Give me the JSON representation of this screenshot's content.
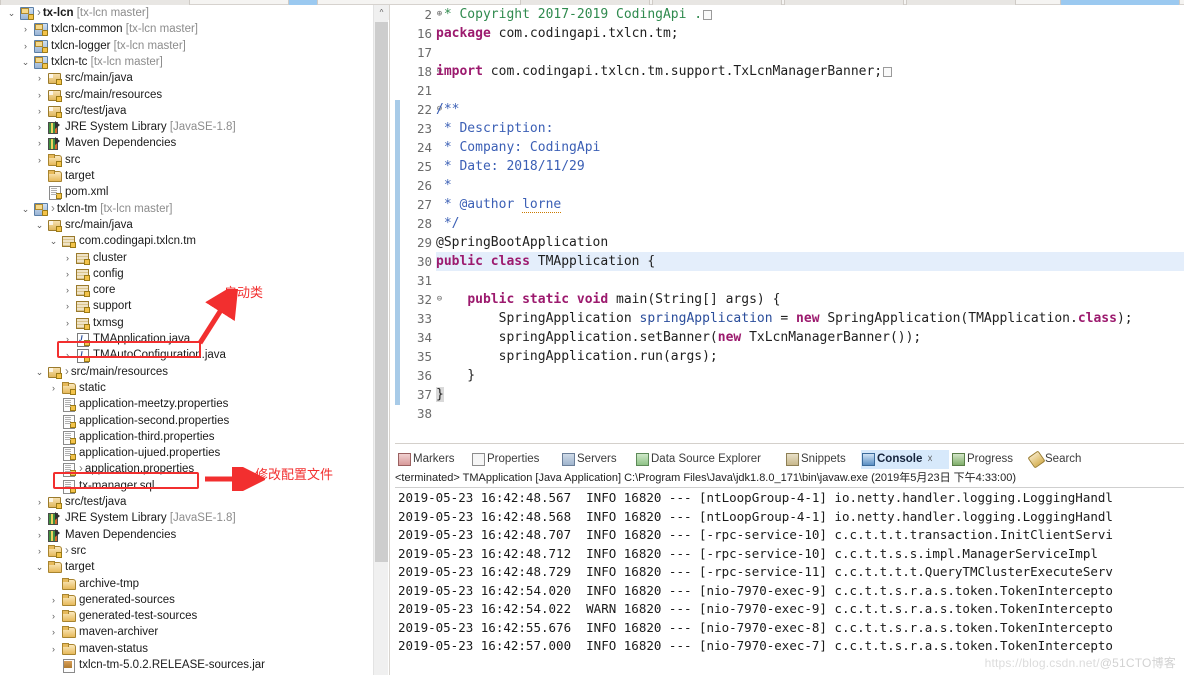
{
  "window": {
    "watermark_url": "https://blog.csdn.net/",
    "watermark_user": "@51CTO博客"
  },
  "explorer": {
    "name": "Package Explorer",
    "rows": [
      {
        "depth": 0,
        "twist": "v",
        "icon": "project",
        "text": "tx-lcn",
        "suffix": "[tx-lcn master]",
        "arrow": true,
        "bold": true
      },
      {
        "depth": 1,
        "twist": ">",
        "icon": "project",
        "text": "txlcn-common",
        "suffix": "[tx-lcn master]",
        "arrow": false,
        "bold": false
      },
      {
        "depth": 1,
        "twist": ">",
        "icon": "project",
        "text": "txlcn-logger",
        "suffix": "[tx-lcn master]",
        "arrow": false,
        "bold": false
      },
      {
        "depth": 1,
        "twist": "v",
        "icon": "project",
        "text": "txlcn-tc",
        "suffix": "[tx-lcn master]",
        "arrow": false,
        "bold": false
      },
      {
        "depth": 2,
        "twist": ">",
        "icon": "srcfolder",
        "text": "src/main/java",
        "suffix": "",
        "arrow": false,
        "bold": false
      },
      {
        "depth": 2,
        "twist": ">",
        "icon": "srcfolder",
        "text": "src/main/resources",
        "suffix": "",
        "arrow": false,
        "bold": false
      },
      {
        "depth": 2,
        "twist": ">",
        "icon": "srcfolder",
        "text": "src/test/java",
        "suffix": "",
        "arrow": false,
        "bold": false
      },
      {
        "depth": 2,
        "twist": ">",
        "icon": "library",
        "text": "JRE System Library",
        "suffix": "[JavaSE-1.8]",
        "arrow": false,
        "bold": false
      },
      {
        "depth": 2,
        "twist": ">",
        "icon": "library",
        "text": "Maven Dependencies",
        "suffix": "",
        "arrow": false,
        "bold": false
      },
      {
        "depth": 2,
        "twist": ">",
        "icon": "folder-src",
        "text": "src",
        "suffix": "",
        "arrow": false,
        "bold": false
      },
      {
        "depth": 2,
        "twist": "",
        "icon": "folder",
        "text": "target",
        "suffix": "",
        "arrow": false,
        "bold": false
      },
      {
        "depth": 2,
        "twist": "",
        "icon": "file-xml",
        "text": "pom.xml",
        "suffix": "",
        "arrow": false,
        "bold": false
      },
      {
        "depth": 1,
        "twist": "v",
        "icon": "project",
        "text": "txlcn-tm",
        "suffix": "[tx-lcn master]",
        "arrow": true,
        "bold": false
      },
      {
        "depth": 2,
        "twist": "v",
        "icon": "srcfolder",
        "text": "src/main/java",
        "suffix": "",
        "arrow": false,
        "bold": false
      },
      {
        "depth": 3,
        "twist": "v",
        "icon": "package",
        "text": "com.codingapi.txlcn.tm",
        "suffix": "",
        "arrow": false,
        "bold": false
      },
      {
        "depth": 4,
        "twist": ">",
        "icon": "package",
        "text": "cluster",
        "suffix": "",
        "arrow": false,
        "bold": false
      },
      {
        "depth": 4,
        "twist": ">",
        "icon": "package",
        "text": "config",
        "suffix": "",
        "arrow": false,
        "bold": false
      },
      {
        "depth": 4,
        "twist": ">",
        "icon": "package",
        "text": "core",
        "suffix": "",
        "arrow": false,
        "bold": false
      },
      {
        "depth": 4,
        "twist": ">",
        "icon": "package",
        "text": "support",
        "suffix": "",
        "arrow": false,
        "bold": false
      },
      {
        "depth": 4,
        "twist": ">",
        "icon": "package",
        "text": "txmsg",
        "suffix": "",
        "arrow": false,
        "bold": false
      },
      {
        "depth": 4,
        "twist": ">",
        "icon": "java",
        "text": "TMApplication.java",
        "suffix": "",
        "arrow": false,
        "bold": false
      },
      {
        "depth": 4,
        "twist": ">",
        "icon": "java",
        "text": "TMAutoConfiguration.java",
        "suffix": "",
        "arrow": false,
        "bold": false
      },
      {
        "depth": 2,
        "twist": "v",
        "icon": "srcfolder",
        "text": "src/main/resources",
        "suffix": "",
        "arrow": true,
        "bold": false
      },
      {
        "depth": 3,
        "twist": ">",
        "icon": "folder-src",
        "text": "static",
        "suffix": "",
        "arrow": false,
        "bold": false
      },
      {
        "depth": 3,
        "twist": "",
        "icon": "file-props",
        "text": "application-meetzy.properties",
        "suffix": "",
        "arrow": false,
        "bold": false
      },
      {
        "depth": 3,
        "twist": "",
        "icon": "file-props",
        "text": "application-second.properties",
        "suffix": "",
        "arrow": false,
        "bold": false
      },
      {
        "depth": 3,
        "twist": "",
        "icon": "file-props",
        "text": "application-third.properties",
        "suffix": "",
        "arrow": false,
        "bold": false
      },
      {
        "depth": 3,
        "twist": "",
        "icon": "file-props",
        "text": "application-ujued.properties",
        "suffix": "",
        "arrow": false,
        "bold": false
      },
      {
        "depth": 3,
        "twist": "",
        "icon": "file-props",
        "text": "application.properties",
        "suffix": "",
        "arrow": true,
        "bold": false
      },
      {
        "depth": 3,
        "twist": "",
        "icon": "file-sql",
        "text": "tx-manager.sql",
        "suffix": "",
        "arrow": false,
        "bold": false
      },
      {
        "depth": 2,
        "twist": ">",
        "icon": "srcfolder",
        "text": "src/test/java",
        "suffix": "",
        "arrow": false,
        "bold": false
      },
      {
        "depth": 2,
        "twist": ">",
        "icon": "library",
        "text": "JRE System Library",
        "suffix": "[JavaSE-1.8]",
        "arrow": false,
        "bold": false
      },
      {
        "depth": 2,
        "twist": ">",
        "icon": "library",
        "text": "Maven Dependencies",
        "suffix": "",
        "arrow": false,
        "bold": false
      },
      {
        "depth": 2,
        "twist": ">",
        "icon": "folder-src",
        "text": "src",
        "suffix": "",
        "arrow": true,
        "bold": false
      },
      {
        "depth": 2,
        "twist": "v",
        "icon": "folder",
        "text": "target",
        "suffix": "",
        "arrow": false,
        "bold": false
      },
      {
        "depth": 3,
        "twist": "",
        "icon": "folder",
        "text": "archive-tmp",
        "suffix": "",
        "arrow": false,
        "bold": false
      },
      {
        "depth": 3,
        "twist": ">",
        "icon": "folder",
        "text": "generated-sources",
        "suffix": "",
        "arrow": false,
        "bold": false
      },
      {
        "depth": 3,
        "twist": ">",
        "icon": "folder",
        "text": "generated-test-sources",
        "suffix": "",
        "arrow": false,
        "bold": false
      },
      {
        "depth": 3,
        "twist": ">",
        "icon": "folder",
        "text": "maven-archiver",
        "suffix": "",
        "arrow": false,
        "bold": false
      },
      {
        "depth": 3,
        "twist": ">",
        "icon": "folder",
        "text": "maven-status",
        "suffix": "",
        "arrow": false,
        "bold": false
      },
      {
        "depth": 3,
        "twist": "",
        "icon": "jar",
        "text": "txlcn-tm-5.0.2.RELEASE-sources.jar",
        "suffix": "",
        "arrow": false,
        "bold": false
      }
    ]
  },
  "annotations": [
    {
      "id": "startup-class",
      "text": "启动类",
      "target": "TMApplication.java"
    },
    {
      "id": "modify-config",
      "text": "修改配置文件",
      "target": "application.properties"
    }
  ],
  "editor": {
    "lines": [
      {
        "num": "2",
        "fold": "+",
        "segs": [
          {
            "t": " * Copyright 2017-2019 CodingApi .",
            "c": "cm"
          },
          {
            "t": "[BOX]",
            "c": "box"
          }
        ]
      },
      {
        "num": "16",
        "fold": "",
        "segs": [
          {
            "t": "package",
            "c": "kw"
          },
          {
            "t": " com.codingapi.txlcn.tm;",
            "c": ""
          }
        ]
      },
      {
        "num": "17",
        "fold": "",
        "segs": []
      },
      {
        "num": "18",
        "fold": "+",
        "segs": [
          {
            "t": "import",
            "c": "kw"
          },
          {
            "t": " com.codingapi.txlcn.tm.support.TxLcnManagerBanner;",
            "c": ""
          },
          {
            "t": "[BOX]",
            "c": "box"
          }
        ]
      },
      {
        "num": "21",
        "fold": "",
        "segs": []
      },
      {
        "num": "22",
        "fold": "-",
        "segs": [
          {
            "t": "/**",
            "c": "jd"
          }
        ]
      },
      {
        "num": "23",
        "fold": "",
        "segs": [
          {
            "t": " * Description:",
            "c": "jd"
          }
        ]
      },
      {
        "num": "24",
        "fold": "",
        "segs": [
          {
            "t": " * Company: CodingApi",
            "c": "jd"
          }
        ]
      },
      {
        "num": "25",
        "fold": "",
        "segs": [
          {
            "t": " * Date: 2018/11/29",
            "c": "jd"
          }
        ]
      },
      {
        "num": "26",
        "fold": "",
        "segs": [
          {
            "t": " *",
            "c": "jd"
          }
        ]
      },
      {
        "num": "27",
        "fold": "",
        "segs": [
          {
            "t": " * @author ",
            "c": "jd"
          },
          {
            "t": "lorne",
            "c": "jd-u"
          }
        ]
      },
      {
        "num": "28",
        "fold": "",
        "segs": [
          {
            "t": " */",
            "c": "jd"
          }
        ]
      },
      {
        "num": "29",
        "fold": "",
        "segs": [
          {
            "t": "@SpringBootApplication",
            "c": "ann"
          }
        ]
      },
      {
        "num": "30",
        "fold": "",
        "hl": true,
        "segs": [
          {
            "t": "public class",
            "c": "kw"
          },
          {
            "t": " TMApplication {",
            "c": ""
          }
        ]
      },
      {
        "num": "31",
        "fold": "",
        "segs": []
      },
      {
        "num": "32",
        "fold": "-",
        "segs": [
          {
            "t": "    ",
            "c": ""
          },
          {
            "t": "public static void",
            "c": "kw"
          },
          {
            "t": " main(String[] args) {",
            "c": ""
          }
        ]
      },
      {
        "num": "33",
        "fold": "",
        "segs": [
          {
            "t": "        SpringApplication ",
            "c": ""
          },
          {
            "t": "springApplication",
            "c": "fld"
          },
          {
            "t": " = ",
            "c": ""
          },
          {
            "t": "new",
            "c": "kw"
          },
          {
            "t": " SpringApplication(TMApplication.",
            "c": ""
          },
          {
            "t": "class",
            "c": "kw"
          },
          {
            "t": ");",
            "c": ""
          }
        ]
      },
      {
        "num": "34",
        "fold": "",
        "segs": [
          {
            "t": "        springApplication.setBanner(",
            "c": ""
          },
          {
            "t": "new",
            "c": "kw"
          },
          {
            "t": " TxLcnManagerBanner());",
            "c": ""
          }
        ]
      },
      {
        "num": "35",
        "fold": "",
        "segs": [
          {
            "t": "        springApplication.run(args);",
            "c": ""
          }
        ]
      },
      {
        "num": "36",
        "fold": "",
        "segs": [
          {
            "t": "    }",
            "c": ""
          }
        ]
      },
      {
        "num": "37",
        "fold": "",
        "segs": [
          {
            "t": "}",
            "c": "brace"
          }
        ]
      },
      {
        "num": "38",
        "fold": "",
        "segs": []
      }
    ]
  },
  "console": {
    "tabs": [
      {
        "label": "Markers",
        "icon": "markers-icon",
        "active": false,
        "close": false
      },
      {
        "label": "Properties",
        "icon": "properties-icon",
        "active": false,
        "close": false
      },
      {
        "label": "Servers",
        "icon": "servers-icon",
        "active": false,
        "close": false
      },
      {
        "label": "Data Source Explorer",
        "icon": "data-source-explorer-icon",
        "active": false,
        "close": false
      },
      {
        "label": "Snippets",
        "icon": "snippets-icon",
        "active": false,
        "close": false
      },
      {
        "label": "Console",
        "icon": "console-icon",
        "active": true,
        "close": true
      },
      {
        "label": "Progress",
        "icon": "progress-icon",
        "active": false,
        "close": false
      },
      {
        "label": "Search",
        "icon": "search-icon",
        "active": false,
        "close": false
      }
    ],
    "terminated_line": "<terminated> TMApplication [Java Application] C:\\Program Files\\Java\\jdk1.8.0_171\\bin\\javaw.exe (2019年5月23日 下午4:33:00)",
    "log_lines": [
      "2019-05-23 16:42:48.567  INFO 16820 --- [ntLoopGroup-4-1] io.netty.handler.logging.LoggingHandl",
      "2019-05-23 16:42:48.568  INFO 16820 --- [ntLoopGroup-4-1] io.netty.handler.logging.LoggingHandl",
      "2019-05-23 16:42:48.707  INFO 16820 --- [-rpc-service-10] c.c.t.t.t.transaction.InitClientServi",
      "2019-05-23 16:42:48.712  INFO 16820 --- [-rpc-service-10] c.c.t.t.s.s.impl.ManagerServiceImpl",
      "2019-05-23 16:42:48.729  INFO 16820 --- [-rpc-service-11] c.c.t.t.t.t.QueryTMClusterExecuteServ",
      "2019-05-23 16:42:54.020  INFO 16820 --- [nio-7970-exec-9] c.c.t.t.s.r.a.s.token.TokenIntercepto",
      "2019-05-23 16:42:54.022  WARN 16820 --- [nio-7970-exec-9] c.c.t.t.s.r.a.s.token.TokenIntercepto",
      "2019-05-23 16:42:55.676  INFO 16820 --- [nio-7970-exec-8] c.c.t.t.s.r.a.s.token.TokenIntercepto",
      "2019-05-23 16:42:57.000  INFO 16820 --- [nio-7970-exec-7] c.c.t.t.s.r.a.s.token.TokenIntercepto"
    ]
  },
  "colors": {
    "annotation_red": "#f22f2f",
    "selection_blue": "#d7e9fb",
    "keyword": "#9c1a6e",
    "comment": "#2f8a4e",
    "javadoc": "#3b5fb5"
  }
}
